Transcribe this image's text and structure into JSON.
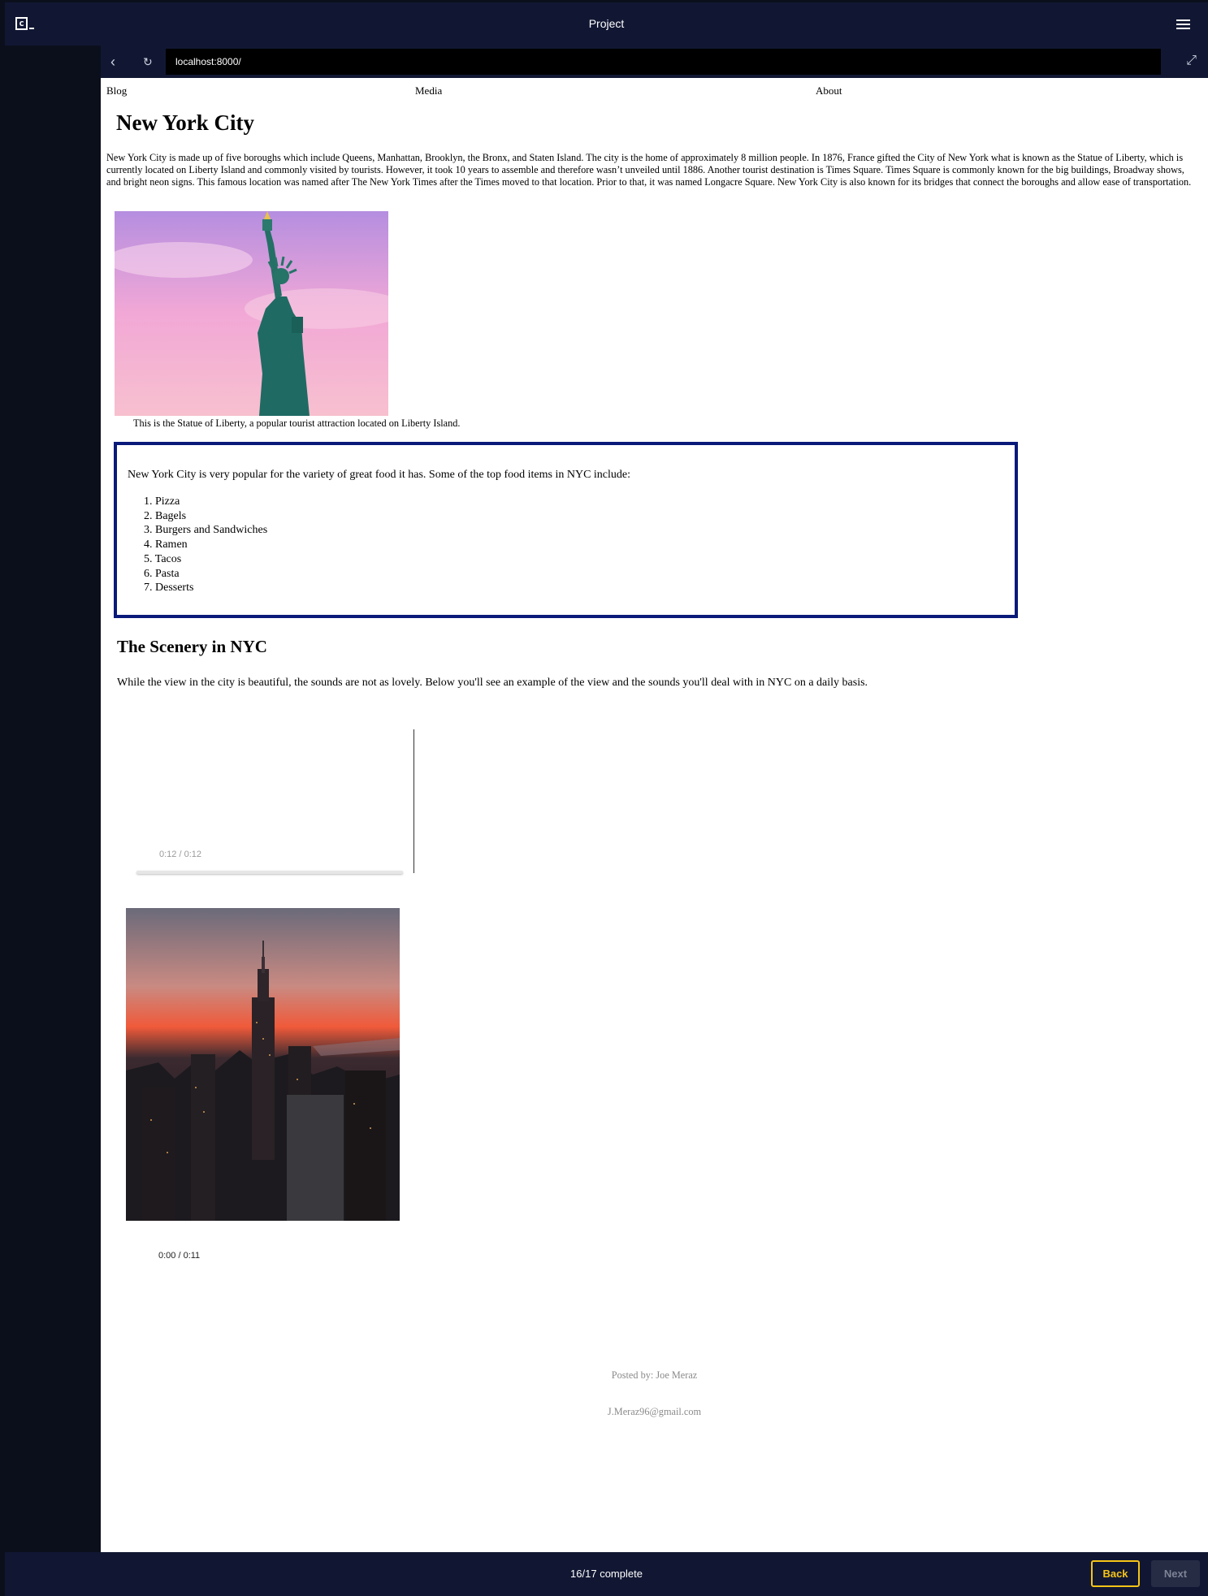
{
  "app": {
    "title": "Project",
    "logo_glyph": "c"
  },
  "browser": {
    "url": "localhost:8000/"
  },
  "site_nav": {
    "items": [
      {
        "label": "Blog"
      },
      {
        "label": "Media"
      },
      {
        "label": "About"
      }
    ]
  },
  "page": {
    "title": "New York City",
    "intro": "New York City is made up of five boroughs which include Queens, Manhattan, Brooklyn, the Bronx, and Staten Island. The city is the home of approximately 8 million people. In 1876, France gifted the City of New York what is known as the Statue of Liberty, which is currently located on Liberty Island and commonly visited by tourists. However, it took 10 years to assemble and therefore wasn’t unveiled until 1886. Another tourist destination is Times Square. Times Square is commonly known for the big buildings, Broadway shows, and bright neon signs. This famous location was named after The New York Times after the Times moved to that location. Prior to that, it was named Longacre Square. New York City is also known for its bridges that connect the boroughs and allow ease of transportation.",
    "liberty_caption": "This is the Statue of Liberty, a popular tourist attraction located on Liberty Island.",
    "food": {
      "intro": "New York City is very popular for the variety of great food it has. Some of the top food items in NYC include:",
      "items": [
        "1. Pizza",
        "2. Bagels",
        "3. Burgers and Sandwiches",
        "4. Ramen",
        "5. Tacos",
        "6. Pasta",
        "7. Desserts"
      ]
    },
    "scenery": {
      "title": "The Scenery in NYC",
      "text": "While the view in the city is beautiful, the sounds are not as lovely. Below you'll see an example of the view and the sounds you'll deal with in NYC on a daily basis."
    },
    "media_a_time": "0:12 / 0:12",
    "media_b_time": "0:00 / 0:11",
    "posted_by": "Posted by: Joe Meraz",
    "email": "J.Meraz96@gmail.com"
  },
  "footer": {
    "progress": "16/17 complete",
    "back_label": "Back",
    "next_label": "Next"
  },
  "colors": {
    "accent": "#f6c417",
    "header_bg": "#111733",
    "box_border": "#0a1a7a"
  }
}
